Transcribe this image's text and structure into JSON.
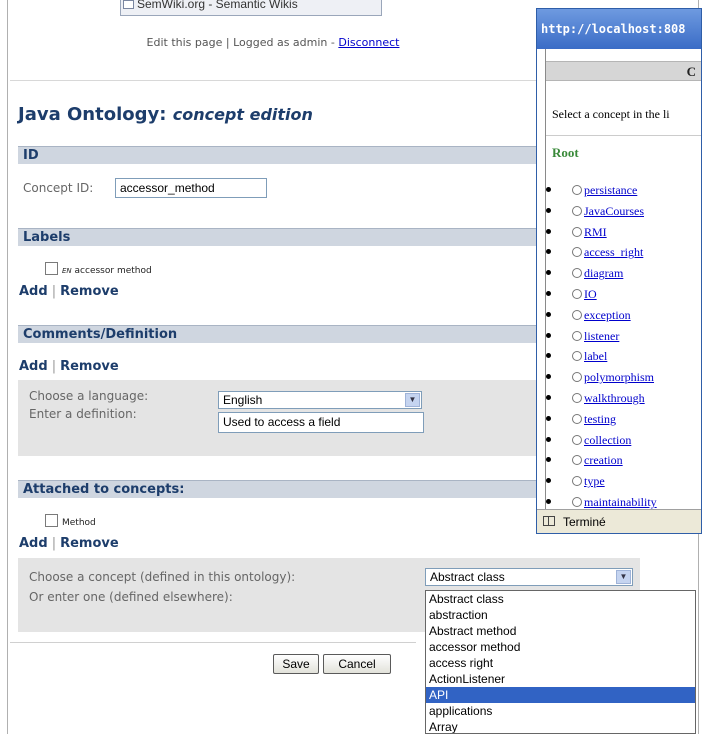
{
  "browser_tab": {
    "label": "SemWiki.org - Semantic Wikis"
  },
  "topbar": {
    "edit_label": "Edit this page",
    "sep": "|",
    "logged_as": "Logged as admin -",
    "disconnect_label": "Disconnect"
  },
  "page": {
    "title_main": "Java Ontology:",
    "title_sub": "concept edition"
  },
  "id_section": {
    "heading": "ID",
    "concept_id_label": "Concept ID:",
    "concept_id_value": "accessor_method"
  },
  "labels_section": {
    "heading": "Labels",
    "label_lang": "EN",
    "label_text": "accessor method",
    "add_label": "Add",
    "remove_label": "Remove",
    "sep": "|"
  },
  "comments_section": {
    "heading": "Comments/Definition",
    "add_label": "Add",
    "remove_label": "Remove",
    "sep": "|",
    "language_label": "Choose a language:",
    "language_value": "English",
    "definition_label": "Enter a definition:",
    "definition_value": "Used to access a field"
  },
  "attached_section": {
    "heading": "Attached to concepts:",
    "concept_text": "Method",
    "add_label": "Add",
    "remove_label": "Remove",
    "sep": "|",
    "choose_label": "Choose a concept (defined in this ontology):",
    "enter_label": "Or enter one (defined elsewhere):",
    "select_value": "Abstract class",
    "options": [
      "Abstract class",
      "abstraction",
      "Abstract method",
      "accessor method",
      "access right",
      "ActionListener",
      "API",
      "applications",
      "Array"
    ],
    "highlighted_option": "API"
  },
  "buttons": {
    "save": "Save",
    "cancel": "Cancel"
  },
  "popup": {
    "title": "http://localhost:808",
    "header": "C",
    "intro": "Select a concept in the li",
    "root_label": "Root",
    "concepts": [
      "persistance",
      "JavaCourses",
      "RMI",
      "access_right",
      "diagram",
      "IO",
      "exception",
      "listener",
      "label",
      "polymorphism",
      "walkthrough",
      "testing",
      "collection",
      "creation",
      "type",
      "maintainability"
    ],
    "status": "Terminé"
  },
  "colors": {
    "heading": "#1d3d6b",
    "section_bar": "#cfd6e0",
    "highlight": "#3163c4",
    "popup_title": "#3a6cc6",
    "root_green": "#3a8a3a"
  }
}
